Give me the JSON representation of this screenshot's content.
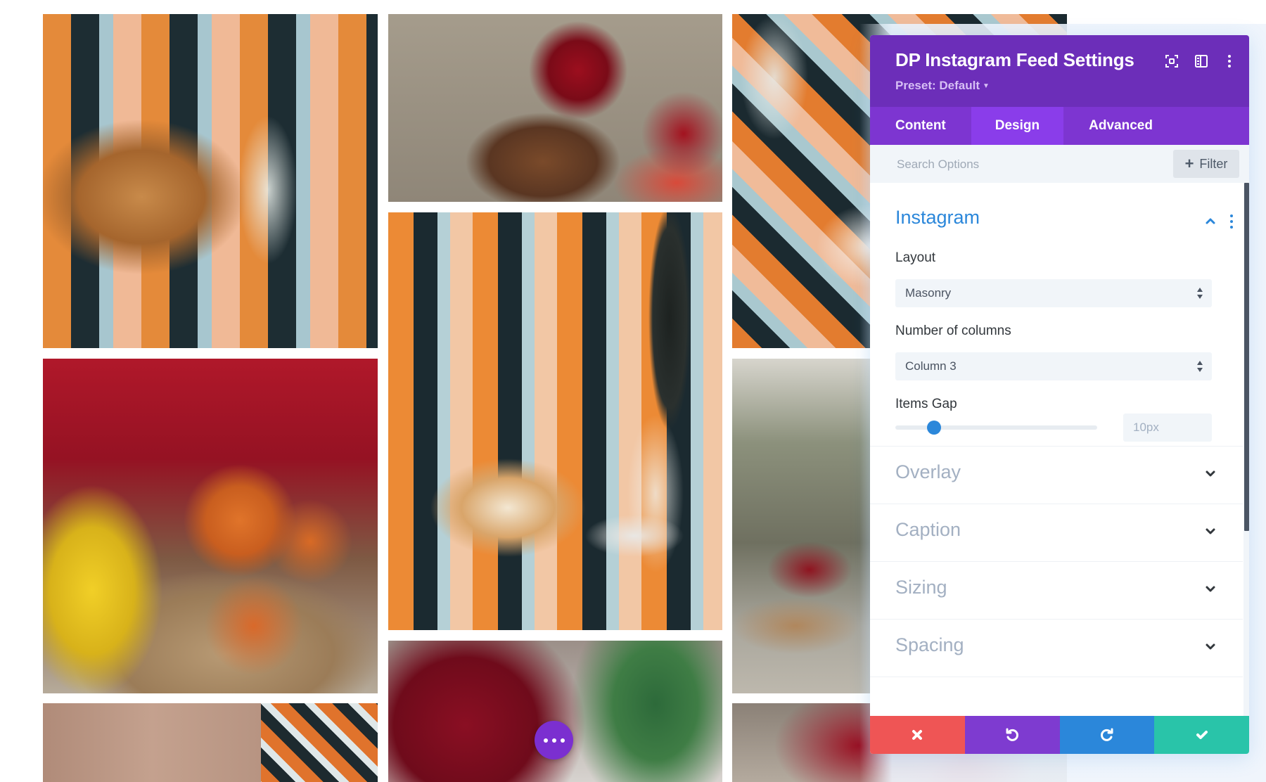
{
  "gallery": {
    "photos": [
      {
        "id": "bread-glass",
        "alt": "Bread and glass on plaid blanket"
      },
      {
        "id": "fruit-basket-flowers",
        "alt": "Basket of fruit with red flowers"
      },
      {
        "id": "plaid-glasses",
        "alt": "Wine glasses and plates on plaid blanket"
      },
      {
        "id": "persimmons-basket",
        "alt": "Persimmons in basket with yellow flowers"
      },
      {
        "id": "picnic-bread-wine",
        "alt": "Picnic with bread, tarts and wine"
      },
      {
        "id": "field-picnic",
        "alt": "Picnic setup in a field"
      },
      {
        "id": "sweater-plaid",
        "alt": "Person in sweater on plaid blanket"
      },
      {
        "id": "red-flowers-basket",
        "alt": "Red flowers in basket"
      },
      {
        "id": "red-flowers-2",
        "alt": "Red flowers"
      }
    ]
  },
  "fab": {
    "icon": "more-horizontal-icon"
  },
  "panel": {
    "title": "DP Instagram Feed Settings",
    "preset_label": "Preset: Default",
    "header_icons": [
      "expand-icon",
      "sidebar-layout-icon",
      "more-vertical-icon"
    ],
    "tabs": [
      {
        "label": "Content",
        "active": false
      },
      {
        "label": "Design",
        "active": true
      },
      {
        "label": "Advanced",
        "active": false
      }
    ],
    "search": {
      "placeholder": "Search Options",
      "value": ""
    },
    "filter_label": "Filter",
    "sections": {
      "instagram": {
        "title": "Instagram",
        "expanded": true,
        "layout": {
          "label": "Layout",
          "value": "Masonry"
        },
        "columns": {
          "label": "Number of columns",
          "value": "Column 3"
        },
        "items_gap": {
          "label": "Items Gap",
          "value": "10px",
          "slider_fraction": 0.19
        }
      },
      "collapsed": [
        {
          "title": "Overlay"
        },
        {
          "title": "Caption"
        },
        {
          "title": "Sizing"
        },
        {
          "title": "Spacing"
        }
      ]
    },
    "footer": {
      "cancel_icon": "close-icon",
      "undo_icon": "undo-icon",
      "redo_icon": "redo-icon",
      "save_icon": "check-icon"
    },
    "colors": {
      "header": "#6c2eb9",
      "tabs": "#7d35d1",
      "active_tab": "#8a3dea",
      "accent_blue": "#2b87da",
      "cancel": "#ef5555",
      "undo": "#7e3bd0",
      "redo": "#2b87da",
      "save": "#29c4a9"
    }
  }
}
